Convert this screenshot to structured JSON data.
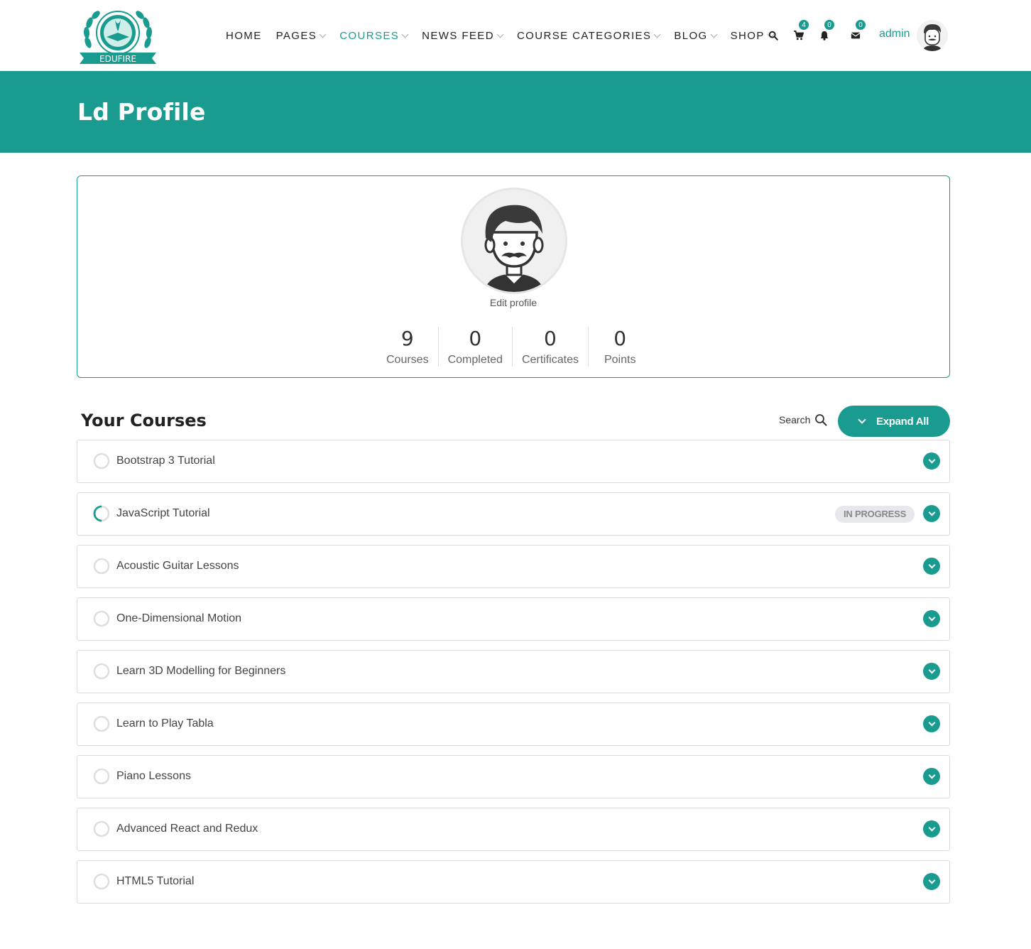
{
  "brand": {
    "name": "EDUFIRE",
    "accent": "#1a9b8f"
  },
  "nav": {
    "items": [
      {
        "label": "HOME",
        "dropdown": false,
        "active": false
      },
      {
        "label": "PAGES",
        "dropdown": true,
        "active": false
      },
      {
        "label": "COURSES",
        "dropdown": true,
        "active": true
      },
      {
        "label": "NEWS FEED",
        "dropdown": true,
        "active": false
      },
      {
        "label": "COURSE CATEGORIES",
        "dropdown": true,
        "active": false
      },
      {
        "label": "BLOG",
        "dropdown": true,
        "active": false
      },
      {
        "label": "SHOP",
        "dropdown": true,
        "active": false
      }
    ],
    "icons": [
      {
        "name": "search-icon",
        "badge": null
      },
      {
        "name": "cart-icon",
        "badge": "4"
      },
      {
        "name": "bell-icon",
        "badge": "0"
      },
      {
        "name": "envelope-icon",
        "badge": "0"
      }
    ],
    "user": "admin"
  },
  "banner": {
    "title": "Ld Profile"
  },
  "profile": {
    "edit_label": "Edit profile",
    "stats": [
      {
        "value": "9",
        "label": "Courses"
      },
      {
        "value": "0",
        "label": "Completed"
      },
      {
        "value": "0",
        "label": "Certificates"
      },
      {
        "value": "0",
        "label": "Points"
      }
    ]
  },
  "courses": {
    "title": "Your Courses",
    "search_label": "Search",
    "expand_label": "Expand All",
    "items": [
      {
        "title": "Bootstrap 3 Tutorial",
        "status": "not-started",
        "badge": ""
      },
      {
        "title": "JavaScript Tutorial",
        "status": "in-progress",
        "badge": "IN PROGRESS"
      },
      {
        "title": "Acoustic Guitar Lessons",
        "status": "not-started",
        "badge": ""
      },
      {
        "title": "One-Dimensional Motion",
        "status": "not-started",
        "badge": ""
      },
      {
        "title": "Learn 3D Modelling for Beginners",
        "status": "not-started",
        "badge": ""
      },
      {
        "title": "Learn to Play Tabla",
        "status": "not-started",
        "badge": ""
      },
      {
        "title": "Piano Lessons",
        "status": "not-started",
        "badge": ""
      },
      {
        "title": "Advanced React and Redux",
        "status": "not-started",
        "badge": ""
      },
      {
        "title": "HTML5 Tutorial",
        "status": "not-started",
        "badge": ""
      }
    ]
  }
}
